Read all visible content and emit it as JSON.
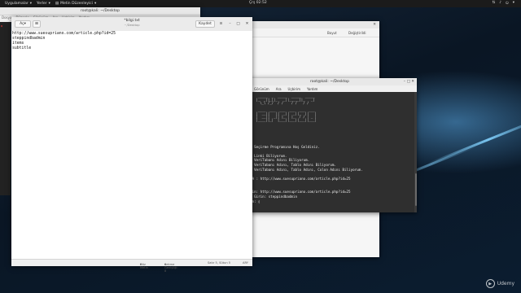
{
  "panel": {
    "applications": "Uygulamalar",
    "places": "Yerler",
    "active_app": "Metin Düzenleyici",
    "clock": "Çrş 02:52"
  },
  "left_window": {
    "title": "root@kali: ~/Desktop",
    "tabs": [
      "Dosya",
      "Düzenle",
      "Görünüm",
      "Ara",
      "Uçbirim",
      "Yardım"
    ]
  },
  "files_window": {
    "columns": [
      "Boyut",
      "Değiştirildi"
    ]
  },
  "terminal": {
    "title": "root@kali: ~/Desktop",
    "menu": [
      "Görünüm",
      "Ara",
      "Uçbirim",
      "Yardım"
    ],
    "banner": "  _____  _  _____  _____  _____ \n |_  _||_||_   _||_____||_   _|\n   \\_\\ /_/  / /    / /   / /  \n\n  ____  ___  ___  ___  ___  ___ \n |  __||   ||  _||  _||_  ||   |\n |  __||  _|| |_ | |_  / / | _ |\n |____||_|  |___||___||___||___|",
    "lines": [
      "",
      "",
      "",
      "",
      "",
      "",
      "",
      "",
      "",
      "",
      "",
      "    Seçirme Programına Hoş Geldiniz.",
      "",
      "  1 Linki Biliyorum.",
      "  2 VeriTabanı Adını Biliyorum.",
      "  3 VeriTabanı Adını, Tablo Adını Biliyorum.",
      "  4 VeriTabanı Adını, Tablo Adını, Colon Adını Biliyorum.",
      "",
      "  RA : http://www.suesupriano.com/article.php?id=25",
      "",
      "  4",
      "  rin: http://www.suesupriano.com/article.php?id=25",
      "  a Girin: steppindbadmin",
      "  in: "
    ]
  },
  "gedit": {
    "open_label": "Aç",
    "save_label": "Kaydet",
    "title": "*bilgi.txt",
    "subtitle": "~/Desktop",
    "lines": [
      "http://www.suesupriano.com/article.php?id=25",
      "steppindbadmin",
      "items",
      "subtitle"
    ],
    "status": {
      "syntax": "Düz Metin",
      "tab_width": "Sekme Genişliği: 8",
      "position": "Satır 5, Sütun 5",
      "mode": "ARY"
    }
  },
  "watermark": "Udemy"
}
